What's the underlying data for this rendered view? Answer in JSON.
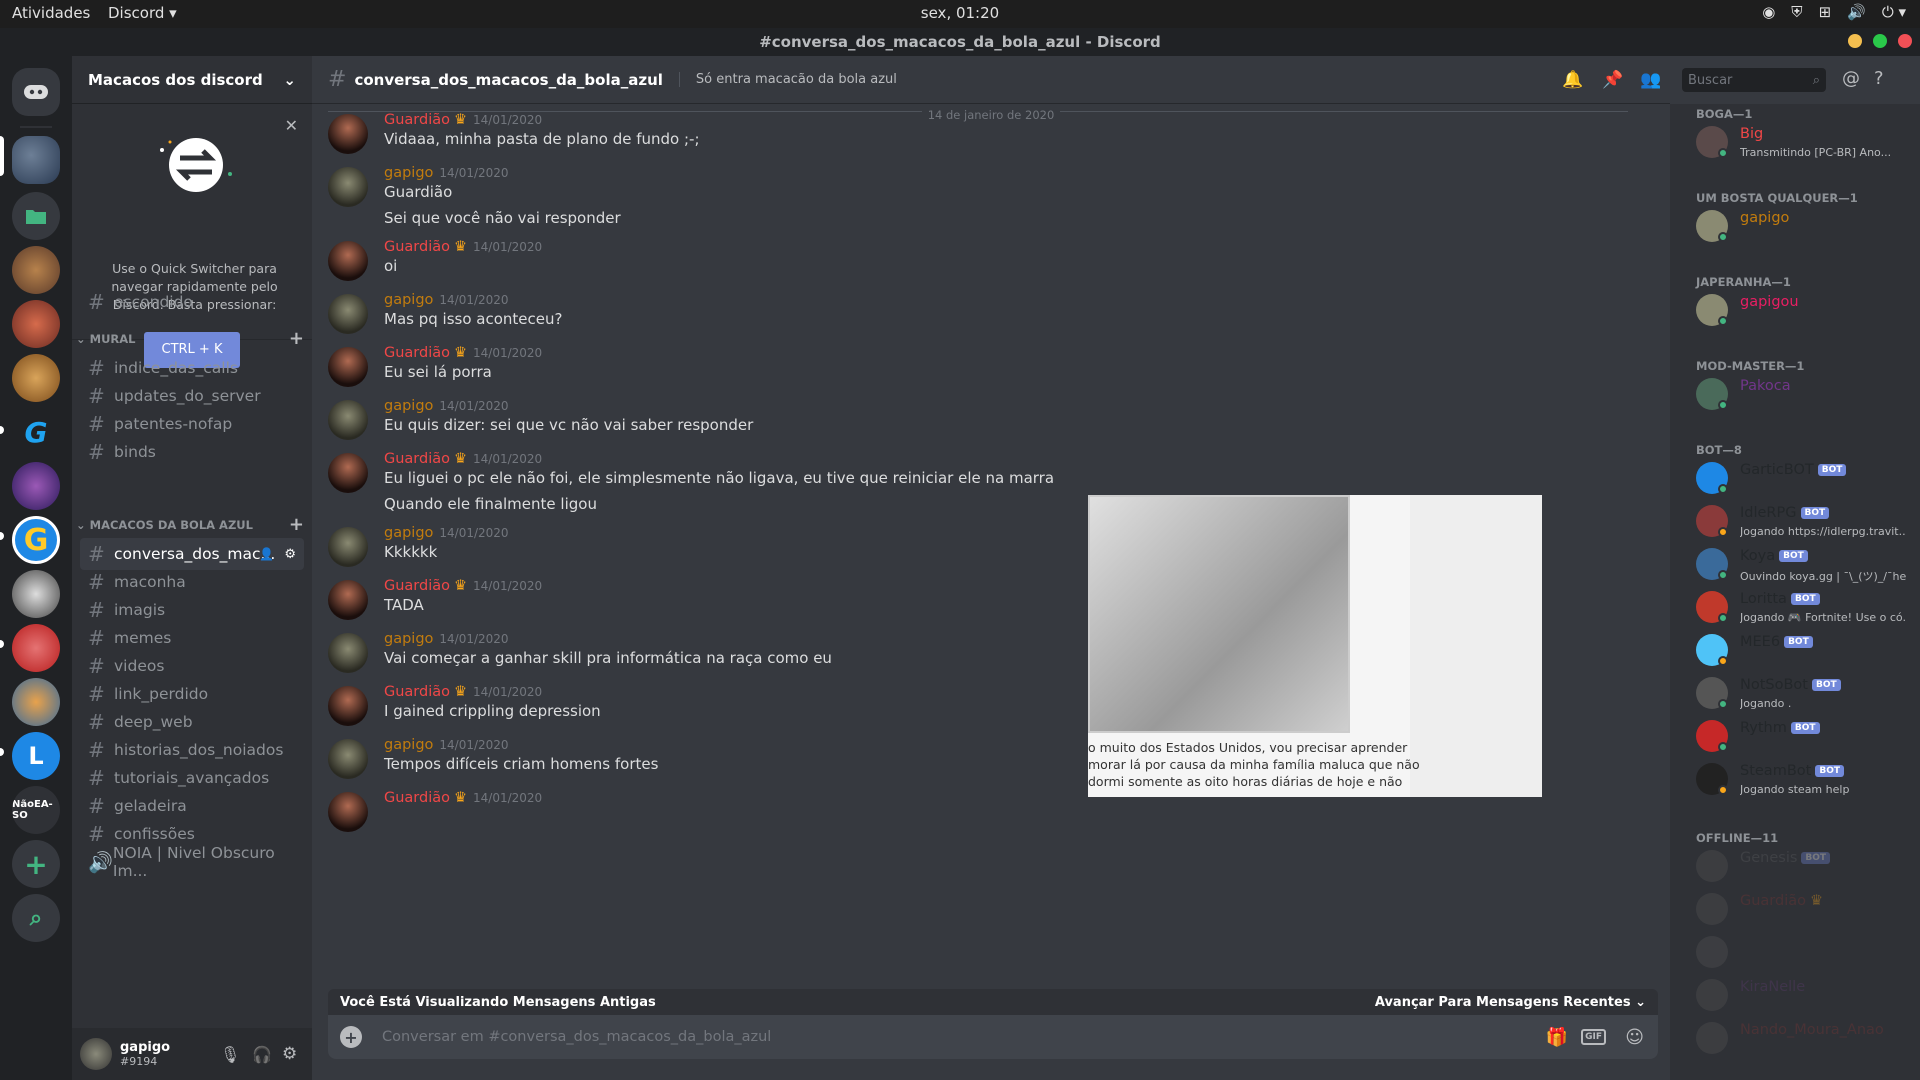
{
  "topbar": {
    "activities": "Atividades",
    "app": "Discord ▾",
    "clock": "sex, 01:20"
  },
  "window": {
    "title": "#conversa_dos_macacos_da_bola_azul - Discord"
  },
  "guilds": [
    {
      "label": "NãoEA-SO"
    }
  ],
  "sidebar": {
    "server_name": "Macacos dos discord",
    "quick_switcher": {
      "text": "Use o Quick Switcher para navegar rapidamente pelo Discord. Basta pressionar:",
      "shortcut": "CTRL + K"
    },
    "top_channels": [
      "escondido"
    ],
    "categories": [
      {
        "name": "MURAL",
        "channels": [
          "indice_das_calls",
          "updates_do_server",
          "patentes-nofap",
          "binds"
        ]
      },
      {
        "name": "MACACOS DA BOLA AZUL",
        "channels": [
          "conversa_dos_mac...",
          "maconha",
          "imagis",
          "memes",
          "videos",
          "link_perdido",
          "deep_web",
          "historias_dos_noiados",
          "tutoriais_avançados",
          "geladeira",
          "confissões",
          "NOIA | Nivel Obscuro Im..."
        ]
      }
    ]
  },
  "user": {
    "name": "gapigo",
    "tag": "#9194"
  },
  "channel": {
    "name": "conversa_dos_macacos_da_bola_azul",
    "topic": "Só entra macacão da bola azul",
    "search_placeholder": "Buscar"
  },
  "date_divider": "14 de janeiro de 2020",
  "messages": [
    {
      "author": "Guardião",
      "crown": true,
      "color": "#f04747",
      "ts": "14/01/2020",
      "lines": [
        "Vidaaa, minha pasta de plano de fundo ;-;"
      ]
    },
    {
      "author": "gapigo",
      "crown": false,
      "color": "#c27c0e",
      "ts": "14/01/2020",
      "lines": [
        "Guardião",
        "Sei que você não vai responder"
      ]
    },
    {
      "author": "Guardião",
      "crown": true,
      "color": "#f04747",
      "ts": "14/01/2020",
      "lines": [
        "oi"
      ]
    },
    {
      "author": "gapigo",
      "crown": false,
      "color": "#c27c0e",
      "ts": "14/01/2020",
      "lines": [
        "Mas pq isso aconteceu?"
      ]
    },
    {
      "author": "Guardião",
      "crown": true,
      "color": "#f04747",
      "ts": "14/01/2020",
      "lines": [
        "Eu sei lá porra"
      ]
    },
    {
      "author": "gapigo",
      "crown": false,
      "color": "#c27c0e",
      "ts": "14/01/2020",
      "lines": [
        "Eu quis dizer: sei que vc não vai saber responder"
      ]
    },
    {
      "author": "Guardião",
      "crown": true,
      "color": "#f04747",
      "ts": "14/01/2020",
      "lines": [
        "Eu liguei o pc ele não foi, ele simplesmente não ligava, eu tive que reiniciar ele na marra",
        "Quando ele finalmente ligou"
      ]
    },
    {
      "author": "gapigo",
      "crown": false,
      "color": "#c27c0e",
      "ts": "14/01/2020",
      "lines": [
        "Kkkkkk"
      ]
    },
    {
      "author": "Guardião",
      "crown": true,
      "color": "#f04747",
      "ts": "14/01/2020",
      "lines": [
        "TADA"
      ]
    },
    {
      "author": "gapigo",
      "crown": false,
      "color": "#c27c0e",
      "ts": "14/01/2020",
      "lines": [
        "Vai começar a ganhar skill pra informática na raça como eu"
      ]
    },
    {
      "author": "Guardião",
      "crown": true,
      "color": "#f04747",
      "ts": "14/01/2020",
      "lines": [
        "I gained crippling depression"
      ]
    },
    {
      "author": "gapigo",
      "crown": false,
      "color": "#c27c0e",
      "ts": "14/01/2020",
      "lines": [
        "Tempos difíceis criam homens fortes"
      ]
    },
    {
      "author": "Guardião",
      "crown": true,
      "color": "#f04747",
      "ts": "14/01/2020",
      "lines": []
    }
  ],
  "embed_text": [
    "o muito dos Estados Unidos, vou precisar aprender",
    "morar lá por causa da minha família maluca que não",
    "dormi somente as oito horas diárias de hoje e não"
  ],
  "old_messages_bar": {
    "left": "Você Está Visualizando Mensagens Antigas",
    "right": "Avançar Para Mensagens Recentes"
  },
  "composer": {
    "placeholder": "Conversar em #conversa_dos_macacos_da_bola_azul"
  },
  "member_groups": [
    {
      "name": "BOGA—1",
      "members": [
        {
          "name": "Big",
          "color": "#f04747",
          "status": "Transmitindo [PC-BR] Ano..."
        }
      ]
    },
    {
      "name": "UM BOSTA QUALQUER—1",
      "members": [
        {
          "name": "gapigo",
          "color": "#c27c0e",
          "status": ""
        }
      ]
    },
    {
      "name": "JAPERANHA—1",
      "members": [
        {
          "name": "gapigou",
          "color": "#e91e63",
          "status": ""
        }
      ]
    },
    {
      "name": "MOD-MASTER—1",
      "members": [
        {
          "name": "Pakoca",
          "color": "#71368a",
          "status": ""
        }
      ]
    },
    {
      "name": "BOT—8",
      "members": [
        {
          "name": "GarticBOT",
          "color": "#23272a",
          "bot": true,
          "status": ""
        },
        {
          "name": "IdleRPG",
          "color": "#23272a",
          "bot": true,
          "status": "Jogando https://idlerpg.travit..."
        },
        {
          "name": "Koya",
          "color": "#23272a",
          "bot": true,
          "status": "Ouvindo koya.gg | ¯\\_(ツ)_/¯help"
        },
        {
          "name": "Loritta",
          "color": "#23272a",
          "bot": true,
          "status": "Jogando 🎮 Fortnite! Use o có..."
        },
        {
          "name": "MEE6",
          "color": "#23272a",
          "bot": true,
          "status": ""
        },
        {
          "name": "NotSoBot",
          "color": "#23272a",
          "bot": true,
          "status": "Jogando ."
        },
        {
          "name": "Rythm",
          "color": "#23272a",
          "bot": true,
          "status": ""
        },
        {
          "name": "SteamBot",
          "color": "#23272a",
          "bot": true,
          "status": "Jogando steam help"
        }
      ]
    },
    {
      "name": "OFFLINE—11",
      "members": [
        {
          "name": "Genesis",
          "color": "#5a5c60",
          "bot": true,
          "status": ""
        },
        {
          "name": "Guardião",
          "color": "#7a3434",
          "status": ""
        },
        {
          "name": "",
          "color": "#6b2a44",
          "status": ""
        },
        {
          "name": "KiraNelle",
          "color": "#5e3c70",
          "status": ""
        },
        {
          "name": "Nando_Moura_Anao",
          "color": "#7a3434",
          "status": ""
        }
      ]
    }
  ],
  "colors": {
    "blurple": "#7289da",
    "bg": "#36393f",
    "sidebar": "#2f3136",
    "guilds": "#202225"
  }
}
